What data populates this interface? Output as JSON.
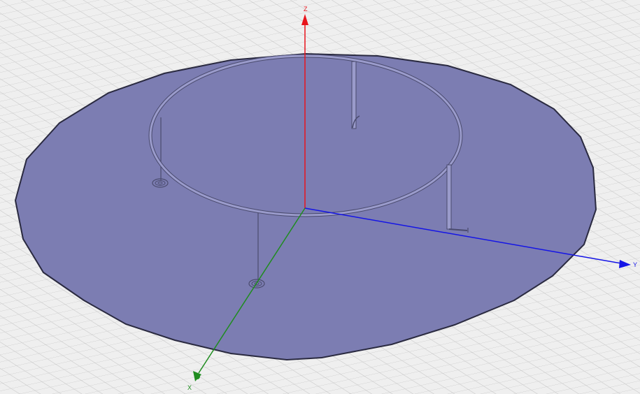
{
  "viewport": {
    "axes": {
      "z": {
        "label": "Z",
        "color": "#e8141c"
      },
      "y": {
        "label": "Y",
        "color": "#1414e6"
      },
      "x": {
        "label": "X",
        "color": "#1f8c1f"
      }
    },
    "colors": {
      "background": "#efefef",
      "grid": "#c8c8c8",
      "ground_plane": "#7c7db2",
      "ground_plane_edge": "#2a2a40",
      "wire": "#9899c8",
      "wire_edge": "#4a4b6e"
    },
    "model": {
      "ground_plane": "circular-ground-plane",
      "loop": "circular-wire-loop",
      "feeds": [
        "feed-port-left",
        "feed-port-front"
      ],
      "posts": [
        "vertical-post-back",
        "vertical-post-right",
        "vertical-post-left",
        "vertical-post-front"
      ]
    }
  }
}
